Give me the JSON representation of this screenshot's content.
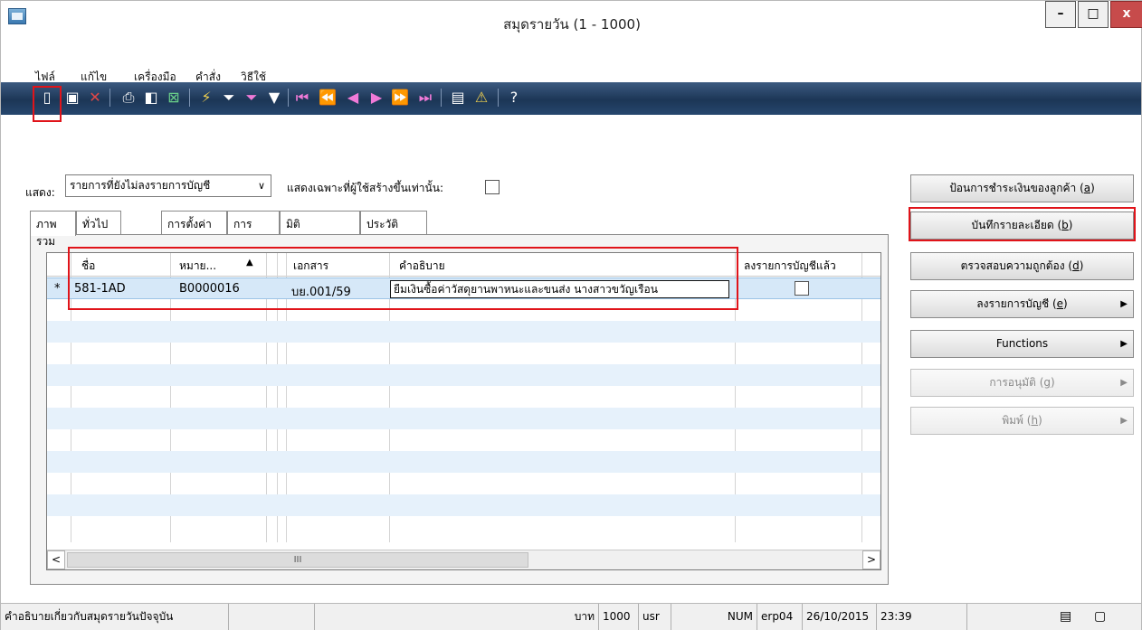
{
  "window": {
    "title": "สมุดรายวัน (1 - 1000)",
    "minimize_label": "–",
    "maximize_label": "□",
    "close_label": "x"
  },
  "menu": [
    "ไฟล์",
    "แก้ไข",
    "เครื่องมือ",
    "คำสั่ง",
    "วิธีใช้"
  ],
  "toolbar": {
    "icons": [
      "new-icon",
      "save-icon",
      "delete-icon",
      "print-icon",
      "print-preview-icon",
      "export-excel-icon",
      "filter-by-selection-icon",
      "filter-by-grid-icon",
      "advanced-filter-icon",
      "remove-filter-icon",
      "first-record-icon",
      "previous-page-icon",
      "previous-record-icon",
      "next-record-icon",
      "next-page-icon",
      "last-record-icon",
      "attachments-icon",
      "alert-icon",
      "help-icon"
    ]
  },
  "filter": {
    "show_label": "แสดง:",
    "show_value": "รายการที่ยังไม่ลงรายการบัญชี",
    "only_label": "แสดงเฉพาะที่ผู้ใช้สร้างขึ้นเท่านั้น:",
    "only_checked": false
  },
  "tabs": [
    "ภาพรวม",
    "ทั่วไป",
    "การตั้งค่า",
    "การบล็อค",
    "มิติ",
    "ประวัติ"
  ],
  "grid": {
    "columns": [
      "ชื่อ",
      "หมาย...",
      "เอกสาร",
      "คำอธิบาย",
      "ลงรายการบัญชีแล้ว"
    ],
    "rows": [
      {
        "marker": "*",
        "name": "581-1AD",
        "number": "B0000016",
        "document": "บย.001/59",
        "description": "ยืมเงินซื้อค่าวัสดุยานพาหนะและขนส่ง นางสาวขวัญเรือน",
        "posted": false
      }
    ],
    "scroll_thumb": "III"
  },
  "actions": [
    {
      "label": "ป้อนการชำระเงินของลูกค้า",
      "key": "a",
      "arrow": false,
      "disabled": false
    },
    {
      "label": "บันทึกรายละเอียด",
      "key": "b",
      "arrow": false,
      "disabled": false
    },
    {
      "label": "ตรวจสอบความถูกต้อง",
      "key": "d",
      "arrow": false,
      "disabled": false
    },
    {
      "label": "ลงรายการบัญชี",
      "key": "e",
      "arrow": true,
      "disabled": false
    },
    {
      "label": "Functions",
      "key": "",
      "arrow": true,
      "disabled": false
    },
    {
      "label": "การอนุมัติ",
      "key": "g",
      "arrow": true,
      "disabled": true
    },
    {
      "label": "พิมพ์",
      "key": "h",
      "arrow": true,
      "disabled": true
    }
  ],
  "status": {
    "message": "คำอธิบายเกี่ยวกับสมุดรายวันปัจจุบัน",
    "currency": "บาท",
    "company": "1000",
    "user": "usr",
    "numlock": "NUM",
    "server": "erp04",
    "date": "26/10/2015",
    "time": "23:39"
  },
  "colors": {
    "highlight": "#e0141a",
    "toolbar": "#1c3656",
    "selected_row": "#d6e8f8"
  }
}
